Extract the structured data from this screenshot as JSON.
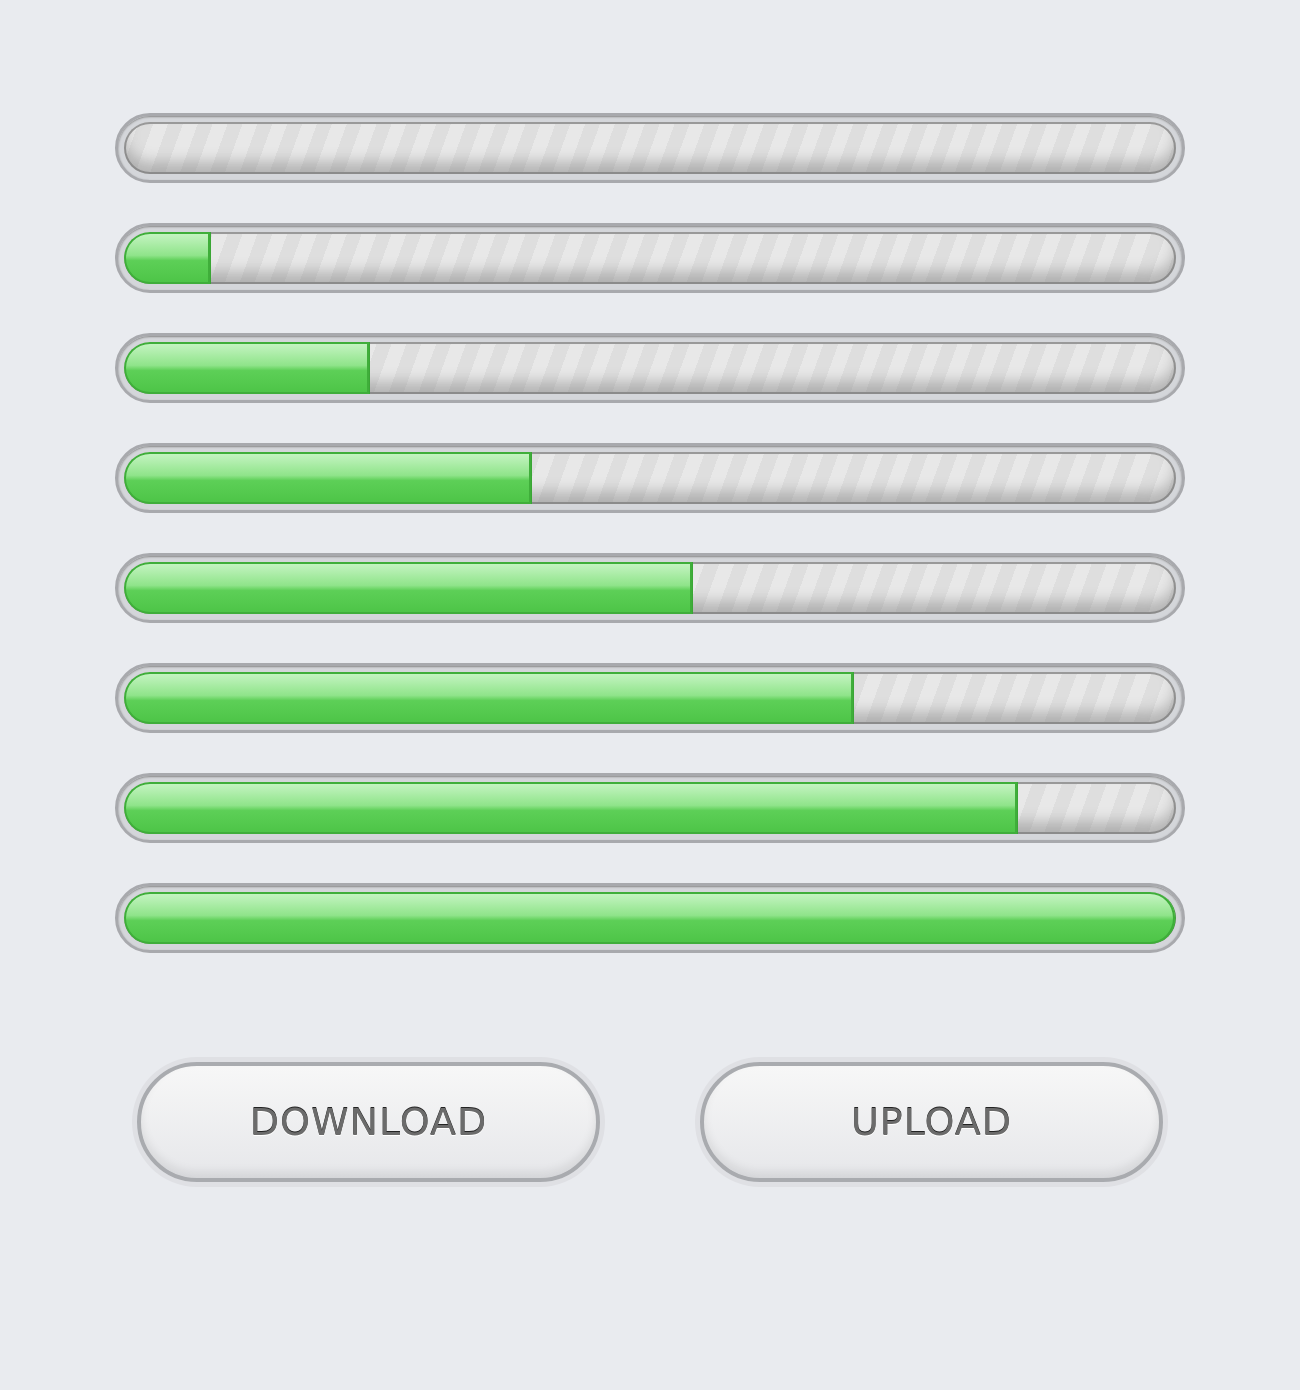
{
  "progress_bars": [
    {
      "level": 0
    },
    {
      "level": 0.083
    },
    {
      "level": 0.234
    },
    {
      "level": 0.388
    },
    {
      "level": 0.541
    },
    {
      "level": 0.694
    },
    {
      "level": 0.85
    },
    {
      "level": 1
    }
  ],
  "buttons": [
    {
      "label": "DOWNLOAD"
    },
    {
      "label": "UPLOAD"
    }
  ]
}
